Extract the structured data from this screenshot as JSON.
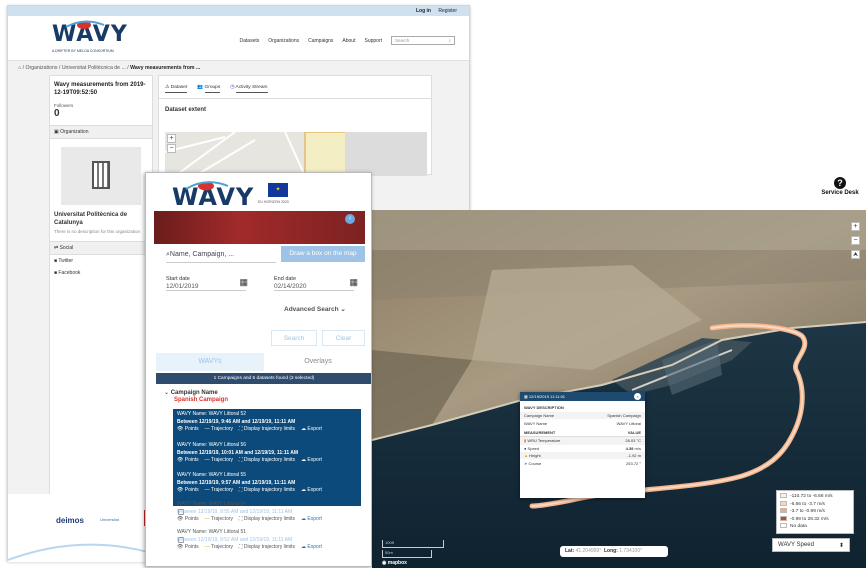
{
  "back": {
    "top_links": [
      "Log in",
      "Register"
    ],
    "logo_text": "WAVY",
    "logo_sub": "A DRIFTER BY MELOA CONSORTIUM",
    "nav": [
      "Datasets",
      "Organizations",
      "Campaigns",
      "About",
      "Support"
    ],
    "search_placeholder": "Search",
    "breadcrumb": [
      "Organizations",
      "Universitat Politècnica de ...",
      "Wavy measurements from ..."
    ],
    "dataset_title": "Wavy measurements from 2019-12-19T09:52:50",
    "followers_label": "Followers",
    "followers_count": "0",
    "org_section": "Organization",
    "org_name": "Universitat Politècnica de Catalunya",
    "org_desc": "There is no description for this organization",
    "social_section": "Social",
    "social_links": [
      "Twitter",
      "Facebook"
    ],
    "tabs": [
      "Dataset",
      "Groups",
      "Activity Stream"
    ],
    "extent_title": "Dataset extent",
    "footer_logos": [
      "deimos",
      "Universitat"
    ]
  },
  "front": {
    "logo_text": "WAVY",
    "eu_caption": "EU HORIZON 2020",
    "search_placeholder": "Name, Campaign, ...",
    "draw_box_btn": "Draw a box on the map",
    "start_label": "Start date",
    "start_value": "12/01/2019",
    "end_label": "End date",
    "end_value": "02/14/2020",
    "advanced": "Advanced Search",
    "search_btn": "Search",
    "clear_btn": "Clear",
    "tab_wavys": "WAVYs",
    "tab_overlays": "Overlays",
    "result_bar": "1 Campaigns and 5 datasets found (3 selected)",
    "campaign_label": "Campaign Name",
    "campaign_name": "Spanish Campaign",
    "opt_points": "Points",
    "opt_trajectory": "Trajectory",
    "opt_limits": "Display trajectory limits",
    "opt_export": "Export",
    "items": [
      {
        "name": "WAVY Name: WAVY Littoral 52",
        "period": "Between 12/19/19, 9:46 AM and 12/19/19, 11:11 AM",
        "selected": true
      },
      {
        "name": "WAVY Name: WAVY Littoral 56",
        "period": "Between 12/19/19, 10:01 AM and 12/19/19, 11:11 AM",
        "selected": true
      },
      {
        "name": "WAVY Name: WAVY Littoral 55",
        "period": "Between 12/19/19, 9:57 AM and 12/19/19, 11:11 AM",
        "selected": true
      },
      {
        "name": "WAVY Name: WAVY Littoral 54",
        "period": "Between 12/19/19, 9:55 AM and 12/19/19, 11:11 AM",
        "selected": false
      },
      {
        "name": "WAVY Name: WAVY Littoral 51",
        "period": "Between 12/19/19, 9:52 AM and 12/19/19, 11:11 AM",
        "selected": false
      }
    ]
  },
  "map": {
    "service_desk": "Service Desk",
    "popup_time": "12/19/2019 11:11:01",
    "popup_desc_head": "WAVY DESCRIPTION",
    "popup_rows": [
      {
        "k": "Campaign Name",
        "v": "Spanish Campaign"
      },
      {
        "k": "WAVY Name",
        "v": "WAVY Littoral"
      }
    ],
    "measure_head": "MEASUREMENT",
    "value_head": "VALUE",
    "measures": [
      {
        "k": "WRU Temperature",
        "v": "26.03",
        "u": "°C"
      },
      {
        "k": "Speed",
        "v": "4.39",
        "u": "m/s"
      },
      {
        "k": "Height",
        "v": "-1.92",
        "u": "m"
      },
      {
        "k": "Course",
        "v": "253.72",
        "u": "°"
      }
    ],
    "legend": [
      {
        "label": "-110.72 to -6.66 m/s",
        "color": "#fdf1e4"
      },
      {
        "label": "-6.66 to -3.7 m/s",
        "color": "#fbd7b5"
      },
      {
        "label": "-3.7 to -0.99 m/s",
        "color": "#f7a77b"
      },
      {
        "label": "-0.99 to 28.32 m/s",
        "color": "#d9421f"
      },
      {
        "label": "No data",
        "color": "#ffffff"
      }
    ],
    "lat_label": "Lat:",
    "lat_value": "41.204999°",
    "lng_label": "Long:",
    "lng_value": "1.734100°",
    "scale1": "100ft",
    "scale2": "50m",
    "speed_select": "WAVY Speed",
    "attribution": "mapbox"
  }
}
